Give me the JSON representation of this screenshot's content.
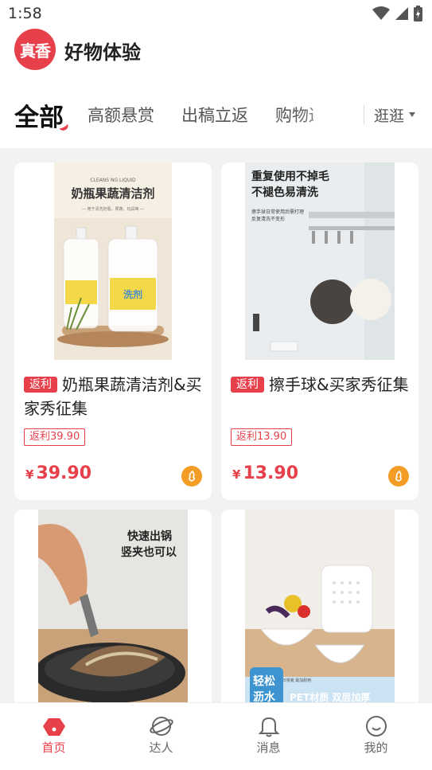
{
  "status_bar": {
    "time": "1:58"
  },
  "header": {
    "logo_text": "真香",
    "title": "好物体验"
  },
  "tabs": [
    {
      "label": "全部"
    },
    {
      "label": "高额悬赏"
    },
    {
      "label": "出稿立返"
    },
    {
      "label": "购物返"
    }
  ],
  "browse": {
    "label": "逛逛"
  },
  "products": [
    {
      "tag": "返利",
      "title": "奶瓶果蔬清洁剂&买家秀征集",
      "rebate": "返利39.90",
      "currency": "¥",
      "price": "39.90",
      "image_text": {
        "line1": "CLEANS NG LIQUID",
        "line2": "奶瓶果蔬清洁剂",
        "line3": "— 用于清洗奶瓶、果蔬、玩具等 —",
        "bottle_label": "洗剂"
      }
    },
    {
      "tag": "返利",
      "title": "擦手球&买家秀征集",
      "rebate": "返利13.90",
      "currency": "¥",
      "price": "13.90",
      "image_text": {
        "line1": "重复使用不掉毛",
        "line2": "不褪色易清洗",
        "line3": "擦手球日常使用后需打理",
        "line4": "反复清洗不变形"
      }
    },
    {
      "image_text": {
        "line1": "快速出锅",
        "line2": "竖夹也可以"
      }
    },
    {
      "image_text": {
        "line1": "轻松",
        "line2": "沥水",
        "line3": "PET材质 双层加厚",
        "line4": "大容量 日常装 最加耐用"
      }
    }
  ],
  "bottom_nav": [
    {
      "label": "首页",
      "active": true
    },
    {
      "label": "达人",
      "active": false
    },
    {
      "label": "消息",
      "active": false
    },
    {
      "label": "我的",
      "active": false
    }
  ],
  "colors": {
    "accent": "#e8404b",
    "coin": "#f39c26"
  }
}
